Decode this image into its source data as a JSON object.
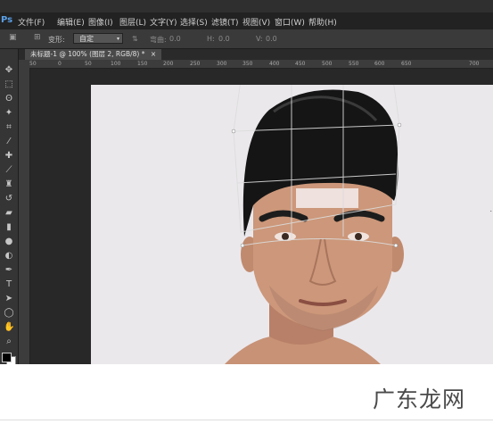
{
  "app": {
    "logo": "Ps",
    "menu": [
      "文件(F)",
      "编辑(E)",
      "图像(I)",
      "图层(L)",
      "文字(Y)",
      "选择(S)",
      "滤镜(T)",
      "视图(V)",
      "窗口(W)",
      "帮助(H)"
    ]
  },
  "options": {
    "transform_label": "变形:",
    "transform_value": "自定",
    "h_label": "弯曲:",
    "h_value": "0.0",
    "hz_label": "H:",
    "hz_value": "0.0",
    "v_label": "V:",
    "v_value": "0.0"
  },
  "document": {
    "tab_title": "未标题-1 @ 100% (图层 2, RGB/8) *",
    "close_glyph": "×"
  },
  "ruler": {
    "top": [
      "50",
      "0",
      "50",
      "100",
      "150",
      "200",
      "250",
      "300",
      "350",
      "400",
      "450",
      "500",
      "550",
      "600",
      "650",
      "700"
    ]
  },
  "tools": [
    "move-tool-icon",
    "marquee-tool-icon",
    "lasso-tool-icon",
    "magic-wand-icon",
    "crop-tool-icon",
    "eyedropper-icon",
    "healing-brush-icon",
    "brush-tool-icon",
    "clone-stamp-icon",
    "history-brush-icon",
    "eraser-icon",
    "gradient-tool-icon",
    "blur-tool-icon",
    "dodge-tool-icon",
    "pen-tool-icon",
    "type-tool-icon",
    "path-select-icon",
    "shape-tool-icon",
    "hand-tool-icon",
    "zoom-tool-icon"
  ],
  "watermark": "广东龙网",
  "colors": {
    "accent": "#5aa0e8",
    "canvas_bg": "#ebe8ec",
    "hair": "#151515",
    "skin": "#c89477"
  }
}
